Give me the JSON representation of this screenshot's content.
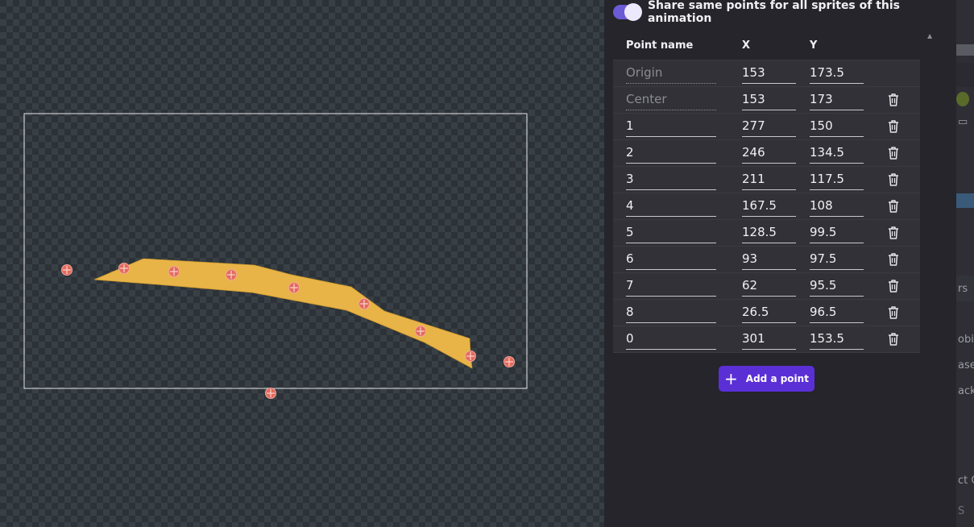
{
  "panel": {
    "share_toggle": {
      "label": "Share same points for all sprites of this animation",
      "on": true
    },
    "columns": {
      "name": "Point name",
      "x": "X",
      "y": "Y"
    },
    "points": [
      {
        "name": "Origin",
        "x": "153",
        "y": "173.5",
        "builtin": true,
        "deletable": false
      },
      {
        "name": "Center",
        "x": "153",
        "y": "173",
        "builtin": true,
        "deletable": true
      },
      {
        "name": "1",
        "x": "277",
        "y": "150",
        "builtin": false,
        "deletable": true
      },
      {
        "name": "2",
        "x": "246",
        "y": "134.5",
        "builtin": false,
        "deletable": true
      },
      {
        "name": "3",
        "x": "211",
        "y": "117.5",
        "builtin": false,
        "deletable": true
      },
      {
        "name": "4",
        "x": "167.5",
        "y": "108",
        "builtin": false,
        "deletable": true
      },
      {
        "name": "5",
        "x": "128.5",
        "y": "99.5",
        "builtin": false,
        "deletable": true
      },
      {
        "name": "6",
        "x": "93",
        "y": "97.5",
        "builtin": false,
        "deletable": true
      },
      {
        "name": "7",
        "x": "62",
        "y": "95.5",
        "builtin": false,
        "deletable": true
      },
      {
        "name": "8",
        "x": "26.5",
        "y": "96.5",
        "builtin": false,
        "deletable": true
      },
      {
        "name": "0",
        "x": "301",
        "y": "153.5",
        "builtin": false,
        "deletable": true
      }
    ],
    "add_button": {
      "label": "Add a point",
      "icon": "plus-icon"
    },
    "delete_icon": "trash-icon"
  },
  "colors": {
    "accent": "#5b2fd6",
    "toggle": "#6b5bd6",
    "sprite": "#e8b447",
    "point_marker": "#e26a5e"
  },
  "edge_fragments": [
    "rs",
    "obi",
    "ase",
    "ackg",
    "ct C",
    "S"
  ]
}
